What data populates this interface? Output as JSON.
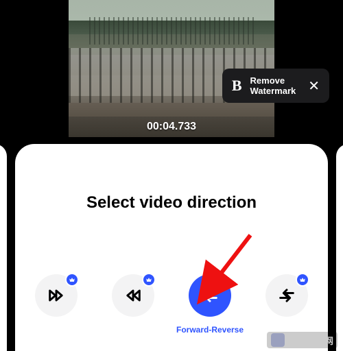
{
  "video": {
    "timestamp": "00:04.733"
  },
  "watermark_banner": {
    "logo_letter": "B",
    "line1": "Remove",
    "line2": "Watermark",
    "close": "✕"
  },
  "panel": {
    "title": "Select video direction",
    "options": [
      {
        "key": "forward",
        "label": "",
        "premium": true,
        "active": false
      },
      {
        "key": "reverse",
        "label": "",
        "premium": true,
        "active": false
      },
      {
        "key": "forward-reverse",
        "label": "Forward-Reverse",
        "premium": false,
        "active": true
      },
      {
        "key": "reverse-forward",
        "label": "",
        "premium": true,
        "active": false
      }
    ]
  },
  "annotation": {
    "arrow_color": "#e11"
  },
  "php_watermark": {
    "text": "中文网"
  }
}
